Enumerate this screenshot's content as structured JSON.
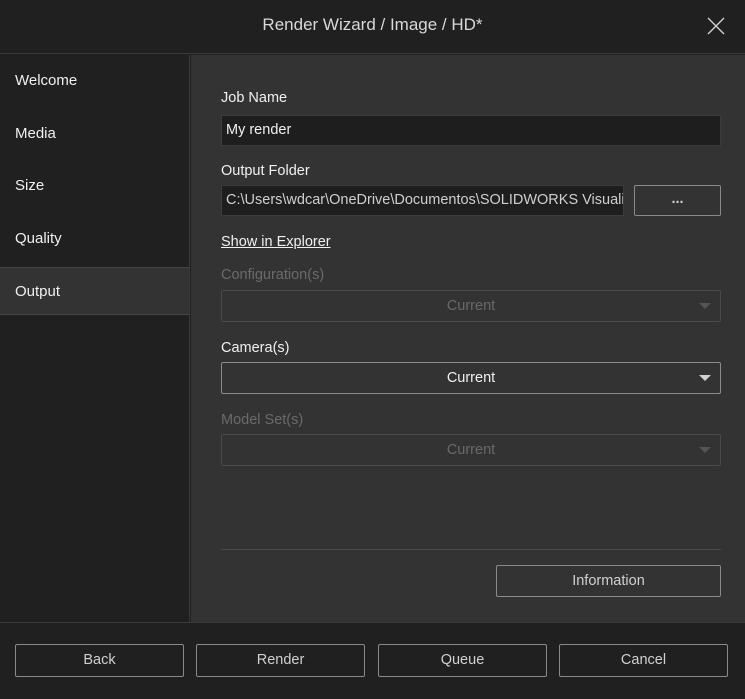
{
  "window": {
    "title": "Render Wizard / Image / HD*"
  },
  "sidebar": {
    "items": [
      {
        "label": "Welcome"
      },
      {
        "label": "Media"
      },
      {
        "label": "Size"
      },
      {
        "label": "Quality"
      },
      {
        "label": "Output",
        "selected": true
      }
    ]
  },
  "main": {
    "job_name": {
      "label": "Job Name",
      "value": "My render"
    },
    "output_folder": {
      "label": "Output Folder",
      "value": "C:\\Users\\wdcar\\OneDrive\\Documentos\\SOLIDWORKS Visualize",
      "browse_label": "..."
    },
    "show_in_explorer": "Show in Explorer",
    "configurations": {
      "label": "Configuration(s)",
      "value": "Current",
      "enabled": false
    },
    "cameras": {
      "label": "Camera(s)",
      "value": "Current",
      "enabled": true
    },
    "model_sets": {
      "label": "Model Set(s)",
      "value": "Current",
      "enabled": false
    },
    "information_label": "Information"
  },
  "footer": {
    "back": "Back",
    "render": "Render",
    "queue": "Queue",
    "cancel": "Cancel"
  }
}
